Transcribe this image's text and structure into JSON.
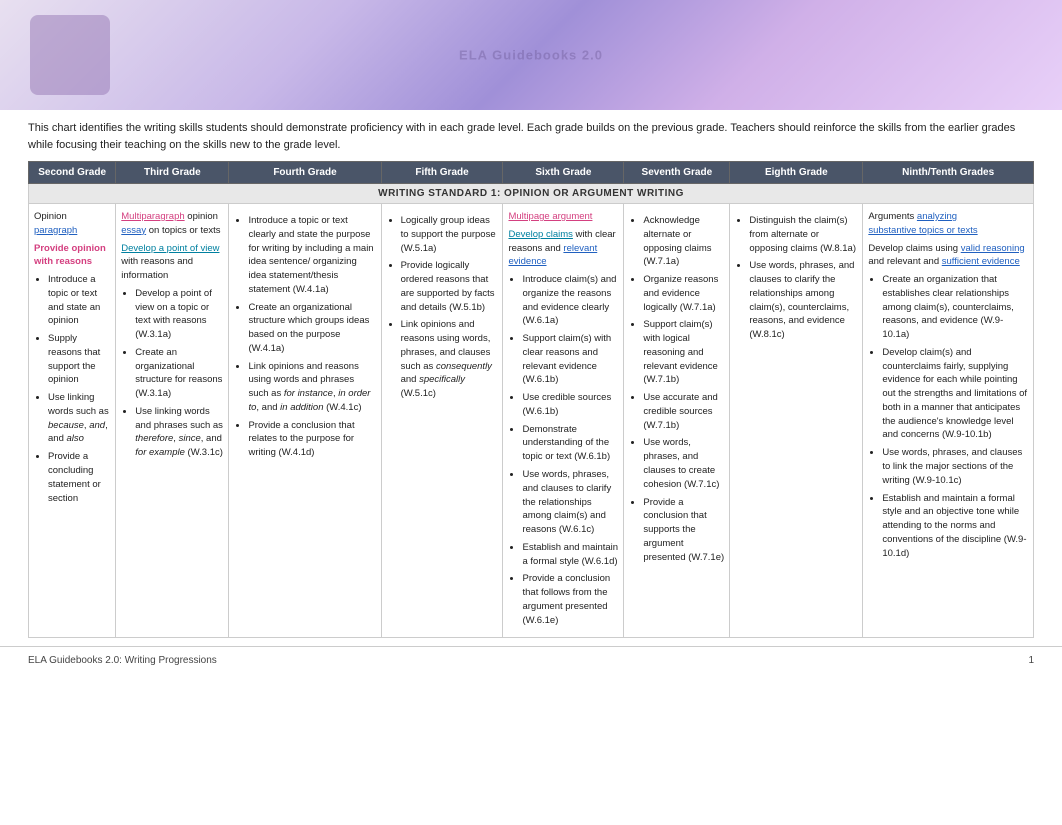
{
  "header": {
    "title": "ELA Guidebooks 2.0: Writing Progressions"
  },
  "intro": {
    "text": "This chart identifies the writing skills students should demonstrate proficiency with in each grade level. Each grade builds on the previous grade. Teachers should reinforce the skills from the earlier grades while focusing their teaching on the skills new to the grade level."
  },
  "table": {
    "standard_label": "WRITING STANDARD 1: OPINION OR ARGUMENT WRITING",
    "grades": [
      "Second Grade",
      "Third Grade",
      "Fourth Grade",
      "Fifth Grade",
      "Sixth Grade",
      "Seventh Grade",
      "Eighth Grade",
      "Ninth/Tenth Grades"
    ],
    "second_grade": {
      "intro_line1": "Opinion ",
      "intro_paragraph": "paragraph",
      "intro_line2_bold_pink": "Provide opinion with reasons",
      "bullets": [
        "Introduce a topic or text and state an opinion",
        "Supply reasons that support the opinion",
        "Use linking words such as because, and, and also",
        "Provide a concluding statement or section"
      ]
    },
    "third_grade": {
      "intro_line1": "Multiparagraph",
      "intro_essay": " opinion ",
      "intro_essay2": "essay",
      "intro_rest": " on topics or texts",
      "intro_line2": "Develop a point of view",
      "intro_line2_rest": " with reasons and information",
      "bullets": [
        "Develop a point of view on a topic or text with reasons (W.3.1a)",
        "Create an organizational structure for reasons (W.3.1a)",
        "Use linking words and phrases such as therefore, since, and for example (W.3.1c)"
      ]
    },
    "fourth_grade": {
      "bullets": [
        "Introduce a topic or text clearly and state the purpose for writing by including a main idea sentence/ organizing idea statement/thesis statement (W.4.1a)",
        "Create an organizational structure which groups ideas based on the purpose (W.4.1a)",
        "Link opinions and reasons using words and phrases such as for instance, in order to, and in addition (W.4.1c)",
        "Provide a conclusion that relates to the purpose for writing (W.4.1d)"
      ]
    },
    "fifth_grade": {
      "bullets": [
        "Logically group ideas to support the purpose (W.5.1a)",
        "Provide logically ordered reasons that are supported by facts and details (W.5.1b)",
        "Link opinions and reasons using words, phrases, and clauses such as consequently and specifically (W.5.1c)"
      ]
    },
    "sixth_grade": {
      "intro_line1": "Multipage argument",
      "intro_line2": "Develop claims",
      "intro_line2_rest": " with clear reasons and ",
      "intro_relevant": "relevant evidence",
      "bullets": [
        "Introduce claim(s) and organize the reasons and evidence clearly (W.6.1a)",
        "Support claim(s) with clear reasons and relevant evidence (W.6.1b)",
        "Use credible sources (W.6.1b)",
        "Demonstrate understanding of the topic or text (W.6.1b)",
        "Use words, phrases, and clauses to clarify the relationships among claim(s) and reasons (W.6.1c)",
        "Establish and maintain a formal style (W.6.1d)",
        "Provide a conclusion that follows from the argument presented (W.6.1e)"
      ]
    },
    "seventh_grade": {
      "bullets": [
        "Acknowledge alternate or opposing claims (W.7.1a)",
        "Organize reasons and evidence logically (W.7.1a)",
        "Support claim(s) with logical reasoning and relevant evidence (W.7.1b)",
        "Use accurate and credible sources (W.7.1b)",
        "Use words, phrases, and clauses to create cohesion (W.7.1c)",
        "Provide a conclusion that supports the argument presented (W.7.1e)"
      ]
    },
    "eighth_grade": {
      "bullets": [
        "Distinguish the claim(s) from alternate or opposing claims (W.8.1a)",
        "Use words, phrases, and clauses to clarify the relationships among claim(s), counterclaims, reasons, and evidence (W.8.1c)"
      ]
    },
    "ninth_tenth_grade": {
      "intro_line1": "Arguments ",
      "intro_analyzing": "analyzing",
      "intro_rest": " ",
      "intro_topics": "substantive topics or texts",
      "intro_line2": "Develop claims using ",
      "intro_valid": "valid reasoning",
      "intro_and": " and relevant and ",
      "intro_sufficient": "sufficient evidence",
      "bullets": [
        "Create an organization that establishes clear relationships among claim(s), counterclaims, reasons, and evidence (W.9-10.1a)",
        "Develop claim(s) and counterclaims fairly, supplying evidence for each while pointing out the strengths and limitations of both in a manner that anticipates the audience's knowledge level and concerns (W.9-10.1b)",
        "Use words, phrases, and clauses to link the major sections of the writing (W.9-10.1c)",
        "Establish and maintain a formal style and an objective tone while attending to the norms and conventions of the discipline (W.9-10.1d)"
      ]
    }
  },
  "footer": {
    "left": "ELA Guidebooks 2.0: Writing Progressions",
    "right": "1"
  }
}
